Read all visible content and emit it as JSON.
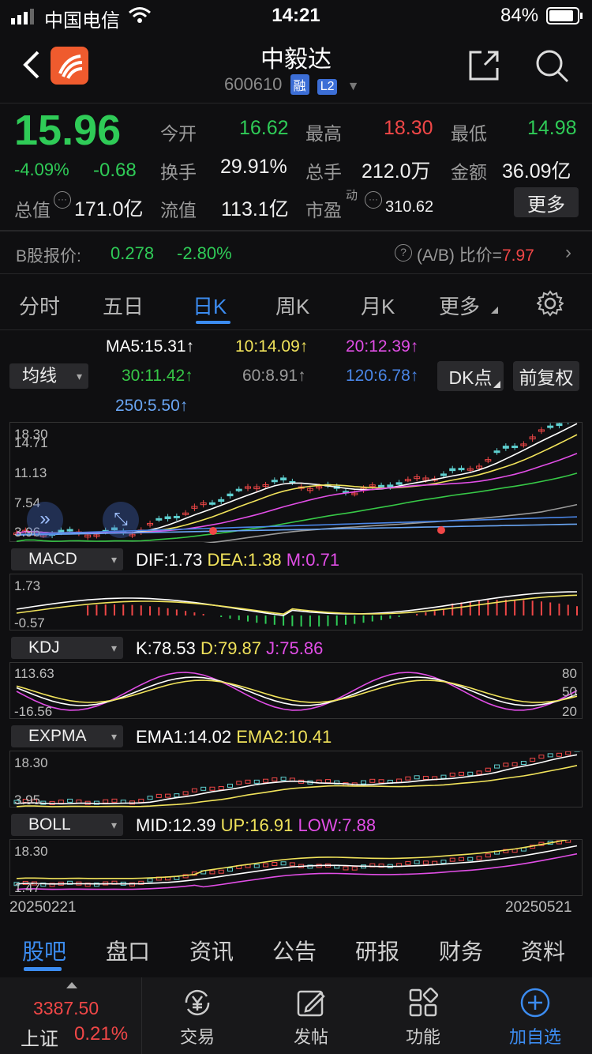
{
  "status_bar": {
    "carrier": "中国电信",
    "time": "14:21",
    "battery": "84%"
  },
  "header": {
    "title": "中毅达",
    "code": "600610",
    "badge1": "融",
    "badge2": "L2"
  },
  "quote": {
    "price": "15.96",
    "change_pct": "-4.09%",
    "change": "-0.68",
    "open_label": "今开",
    "open": "16.62",
    "high_label": "最高",
    "high": "18.30",
    "low_label": "最低",
    "low": "14.98",
    "turnover_label": "换手",
    "turnover": "29.91%",
    "volume_label": "总手",
    "volume": "212.0万",
    "amount_label": "金额",
    "amount": "36.09亿",
    "mktcap_label": "总值",
    "mktcap": "171.0亿",
    "float_label": "流值",
    "float": "113.1亿",
    "pe_label": "市盈",
    "pe_sup": "动",
    "pe": "310.62",
    "more_label": "更多"
  },
  "bshare": {
    "label": "B股报价:",
    "price": "0.278",
    "pct": "-2.80%",
    "ratio_label": "(A/B) 比价=",
    "ratio": "7.97"
  },
  "period_tabs": [
    "分时",
    "五日",
    "日K",
    "周K",
    "月K",
    "更多"
  ],
  "ma": {
    "ma5": "MA5:15.31↑",
    "ma10": "10:14.09↑",
    "ma20": "20:12.39↑",
    "ma30": "30:11.42↑",
    "ma60": "60:8.91↑",
    "ma120": "120:6.78↑",
    "ma250": "250:5.50↑",
    "selector": "均线",
    "dk": "DK点",
    "adjust": "前复权"
  },
  "main_chart": {
    "y_labels": [
      "18.30",
      "14.71",
      "11.13",
      "7.54",
      "3.96"
    ]
  },
  "macd": {
    "name": "MACD",
    "dif": "DIF:1.73",
    "dea": "DEA:1.38",
    "m": "M:0.71",
    "y_top": "1.73",
    "y_bottom": "-0.57"
  },
  "kdj": {
    "name": "KDJ",
    "k": "K:78.53",
    "d": "D:79.87",
    "j": "J:75.86",
    "y_top": "113.63",
    "y_bottom": "-16.56",
    "r80": "80",
    "r50": "50",
    "r20": "20"
  },
  "expma": {
    "name": "EXPMA",
    "ema1": "EMA1:14.02",
    "ema2": "EMA2:10.41",
    "y_top": "18.30",
    "y_bottom": "3.95"
  },
  "boll": {
    "name": "BOLL",
    "mid": "MID:12.39",
    "up": "UP:16.91",
    "low": "LOW:7.88",
    "y_top": "18.30",
    "y_bottom": "1.47"
  },
  "dates": {
    "start": "20250221",
    "end": "20250521"
  },
  "bottom_tabs": [
    "股吧",
    "盘口",
    "资讯",
    "公告",
    "研报",
    "财务",
    "资料"
  ],
  "footer": {
    "index_value": "3387.50",
    "index_name": "上证",
    "index_pct": "0.21%",
    "trade": "交易",
    "post": "发帖",
    "func": "功能",
    "add": "加自选"
  },
  "colors": {
    "up": "#f04747",
    "down": "#2fcb57",
    "ma5": "#ffffff",
    "ma10": "#f1e35b",
    "ma20": "#e14ee6",
    "ma30": "#37c847",
    "ma60": "#9a9a9a",
    "ma120": "#4a86e8",
    "accent": "#3c8cf0"
  }
}
